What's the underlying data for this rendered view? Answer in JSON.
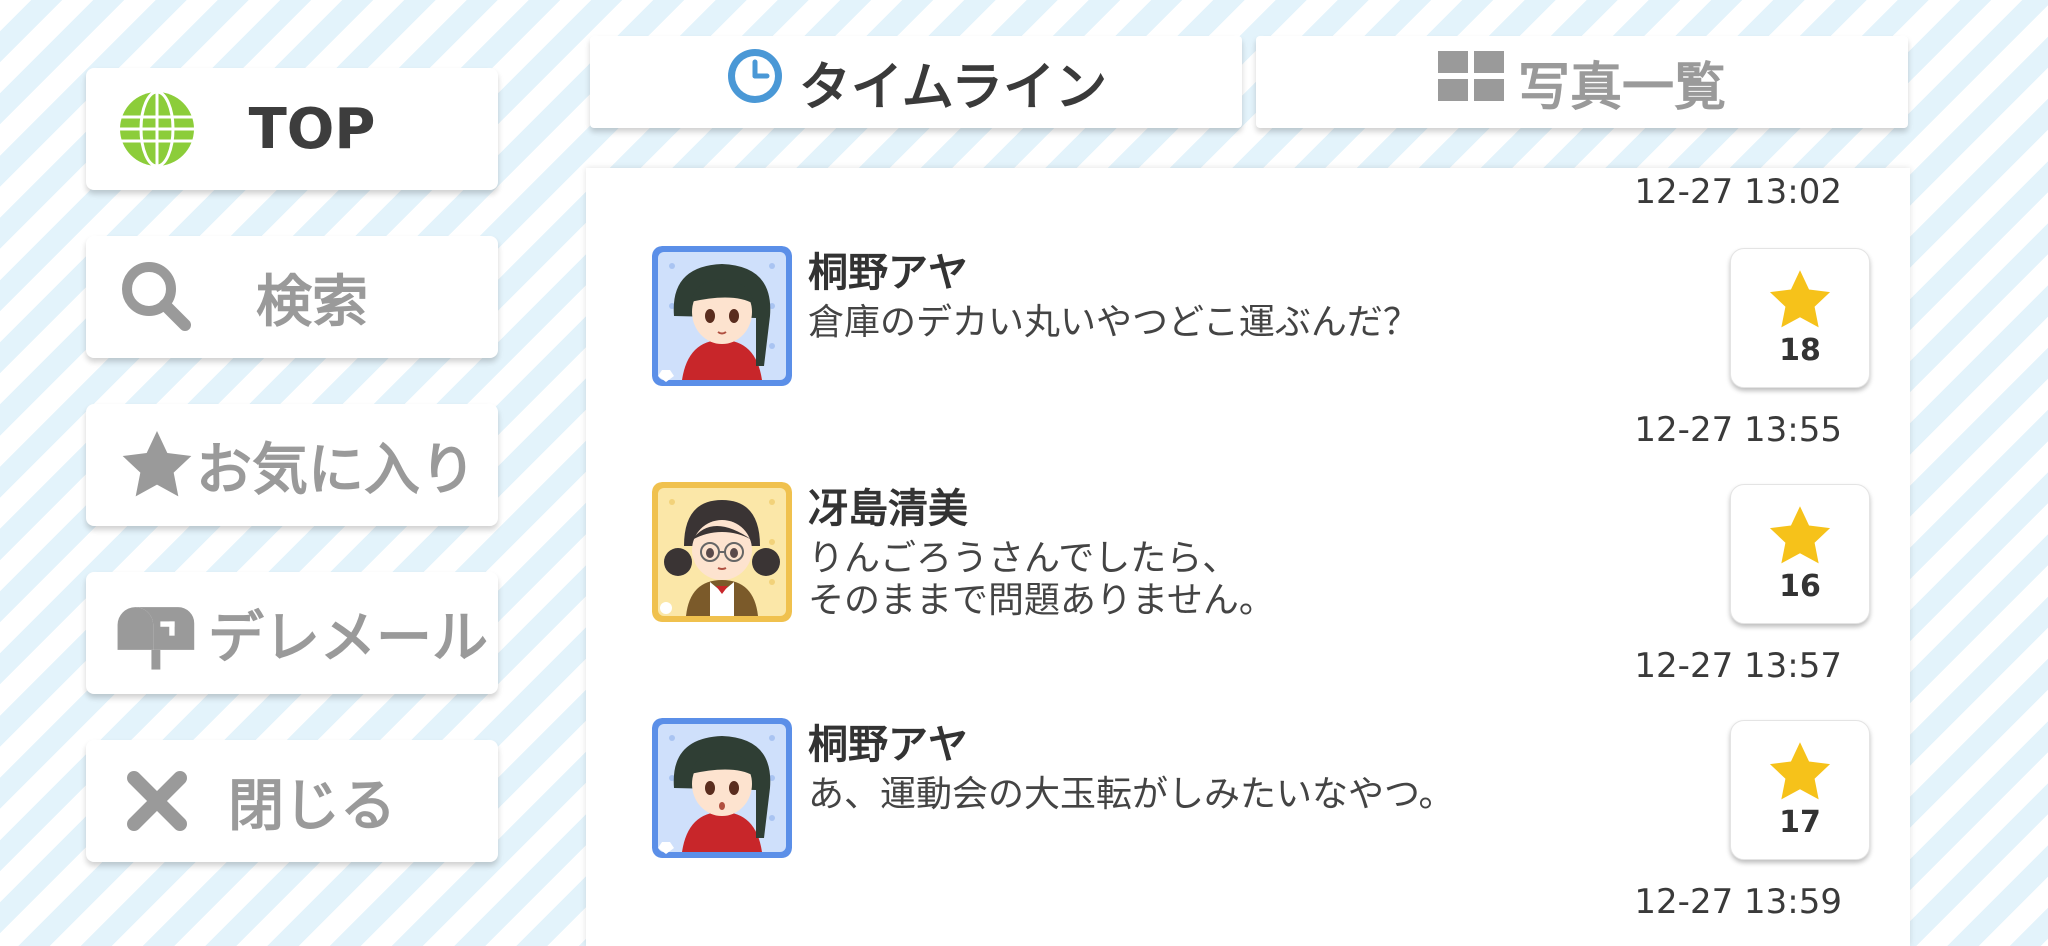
{
  "sidebar": {
    "items": [
      {
        "label": "TOP",
        "icon": "globe-icon",
        "active": true
      },
      {
        "label": "検索",
        "icon": "search-icon"
      },
      {
        "label": "お気に入り",
        "icon": "star-icon"
      },
      {
        "label": "デレメール",
        "icon": "mailbox-icon"
      },
      {
        "label": "閉じる",
        "icon": "close-icon"
      }
    ]
  },
  "tabs": [
    {
      "label": "タイムライン",
      "icon": "clock-icon",
      "active": true
    },
    {
      "label": "写真一覧",
      "icon": "grid-icon",
      "active": false
    }
  ],
  "timeline": {
    "top_timestamp": "12-27 13:02",
    "posts": [
      {
        "name": "桐野アヤ",
        "message": "倉庫のデカい丸いやつどこ運ぶんだ？",
        "likes": "18",
        "timestamp": "12-27 13:55"
      },
      {
        "name": "冴島清美",
        "message": "りんごろうさんでしたら、\nそのままで問題ありません。",
        "likes": "16",
        "timestamp": "12-27 13:57"
      },
      {
        "name": "桐野アヤ",
        "message": "あ、運動会の大玉転がしみたいなやつ。",
        "likes": "17",
        "timestamp": "12-27 13:59"
      }
    ]
  },
  "colors": {
    "accent_blue": "#4a98d6",
    "globe_green": "#8ccd3a",
    "star_yellow": "#f6c21a",
    "avatar_blue_frame": "#5b8fe8",
    "avatar_gold_frame": "#f0c14e"
  }
}
